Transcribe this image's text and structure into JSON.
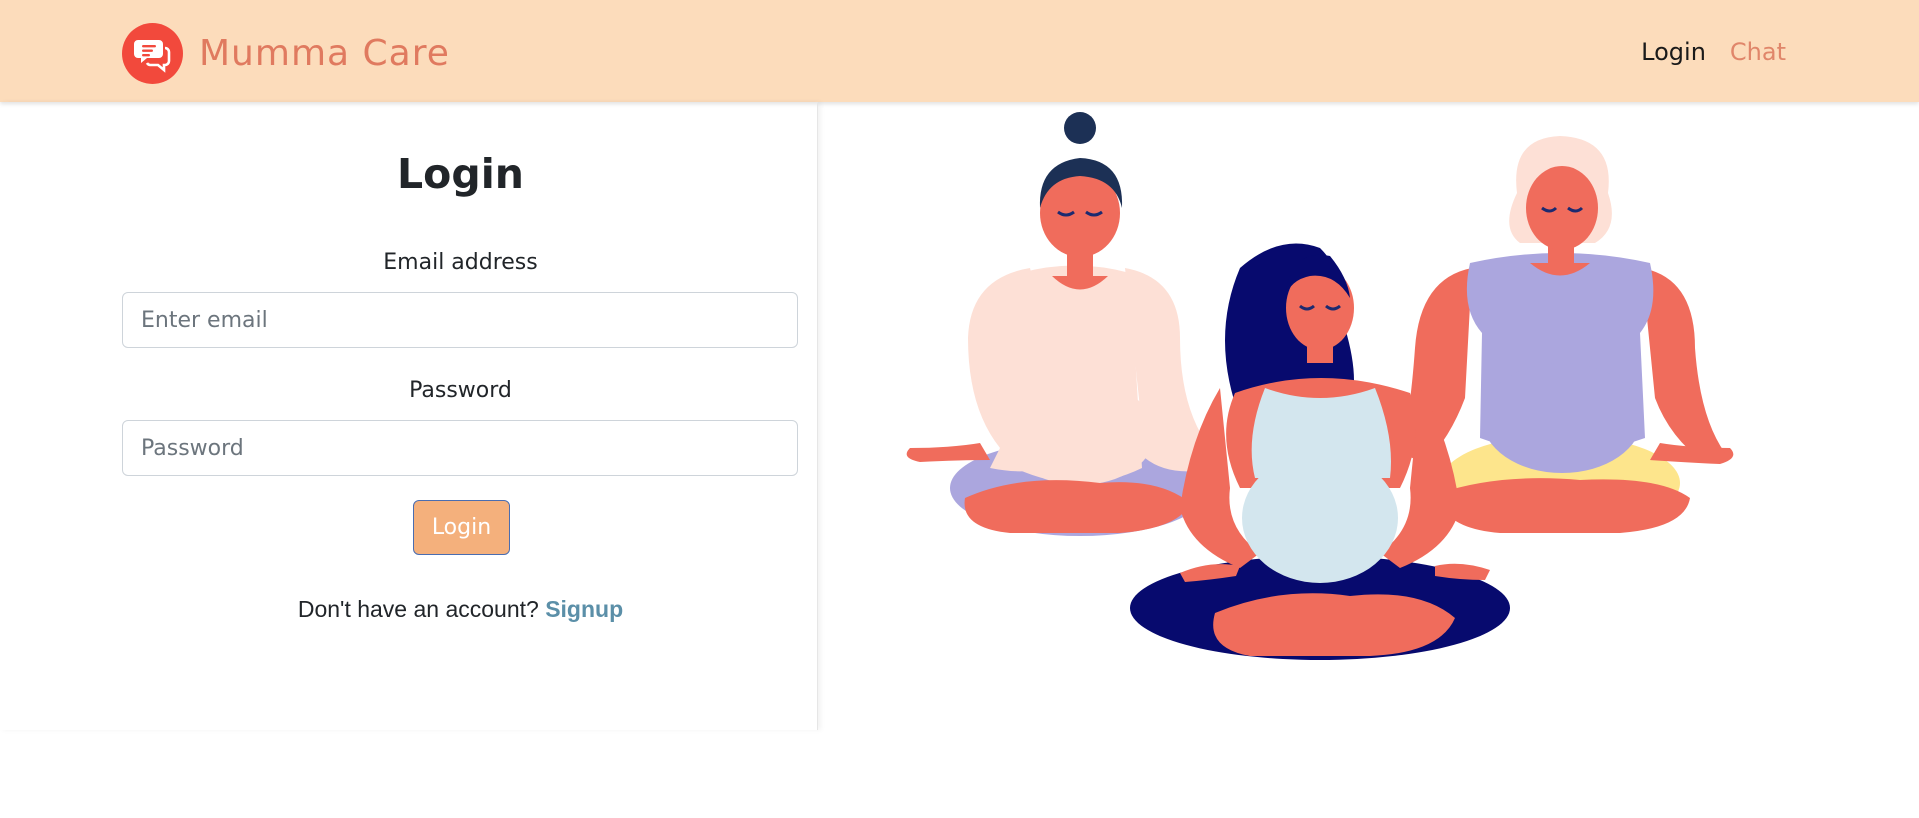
{
  "navbar": {
    "brand": "Mumma Care",
    "links": {
      "login": "Login",
      "chat": "Chat"
    }
  },
  "icons": {
    "logo": "chat-bubbles-icon"
  },
  "colors": {
    "navbar_bg": "#fcdcbb",
    "brand": "#e07a5f",
    "logo_bg": "#f2493c",
    "button_bg": "#f4b07c",
    "signup_link": "#5b8fa8"
  },
  "form": {
    "title": "Login",
    "email_label": "Email address",
    "email_placeholder": "Enter email",
    "email_value": "",
    "password_label": "Password",
    "password_placeholder": "Password",
    "password_value": "",
    "submit_label": "Login",
    "signup_prompt": "Don't have an account?",
    "signup_link": "Signup"
  },
  "illustration": {
    "subject": "three-pregnant-women-meditating"
  }
}
